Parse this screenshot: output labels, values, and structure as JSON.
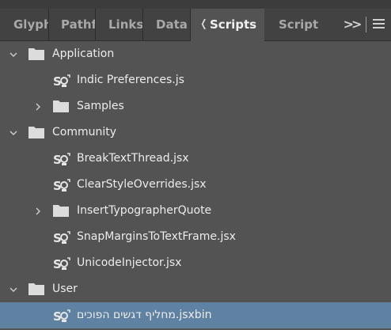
{
  "tabs": [
    {
      "label": "Glyph",
      "active": false
    },
    {
      "label": "Pathf",
      "active": false
    },
    {
      "label": "Links",
      "active": false
    },
    {
      "label": "Data I",
      "active": false
    },
    {
      "label": "Scripts",
      "active": true
    },
    {
      "label": "Script",
      "active": false
    }
  ],
  "tab_overflow_icon": "double-chevron-right-icon",
  "panel_menu_icon": "hamburger-menu-icon",
  "tree": [
    {
      "label": "Application",
      "type": "folder",
      "expanded": true,
      "depth": 0
    },
    {
      "label": "Indic Preferences.js",
      "type": "script",
      "depth": 1
    },
    {
      "label": "Samples",
      "type": "folder",
      "expanded": false,
      "depth": 1
    },
    {
      "label": "Community",
      "type": "folder",
      "expanded": true,
      "depth": 0
    },
    {
      "label": "BreakTextThread.jsx",
      "type": "script",
      "depth": 1
    },
    {
      "label": "ClearStyleOverrides.jsx",
      "type": "script",
      "depth": 1
    },
    {
      "label": "InsertTypographerQuote",
      "type": "folder",
      "expanded": false,
      "depth": 1
    },
    {
      "label": "SnapMarginsToTextFrame.jsx",
      "type": "script",
      "depth": 1
    },
    {
      "label": "UnicodeInjector.jsx",
      "type": "script",
      "depth": 1
    },
    {
      "label": "User",
      "type": "folder",
      "expanded": true,
      "depth": 0
    },
    {
      "label": "מחליף דגשים הפוכים.jsxbin",
      "type": "script",
      "depth": 1,
      "selected": true
    }
  ],
  "colors": {
    "panel_bg": "#535353",
    "tabbar_bg": "#424242",
    "selection": "#5f82a3",
    "text": "#ececec"
  }
}
